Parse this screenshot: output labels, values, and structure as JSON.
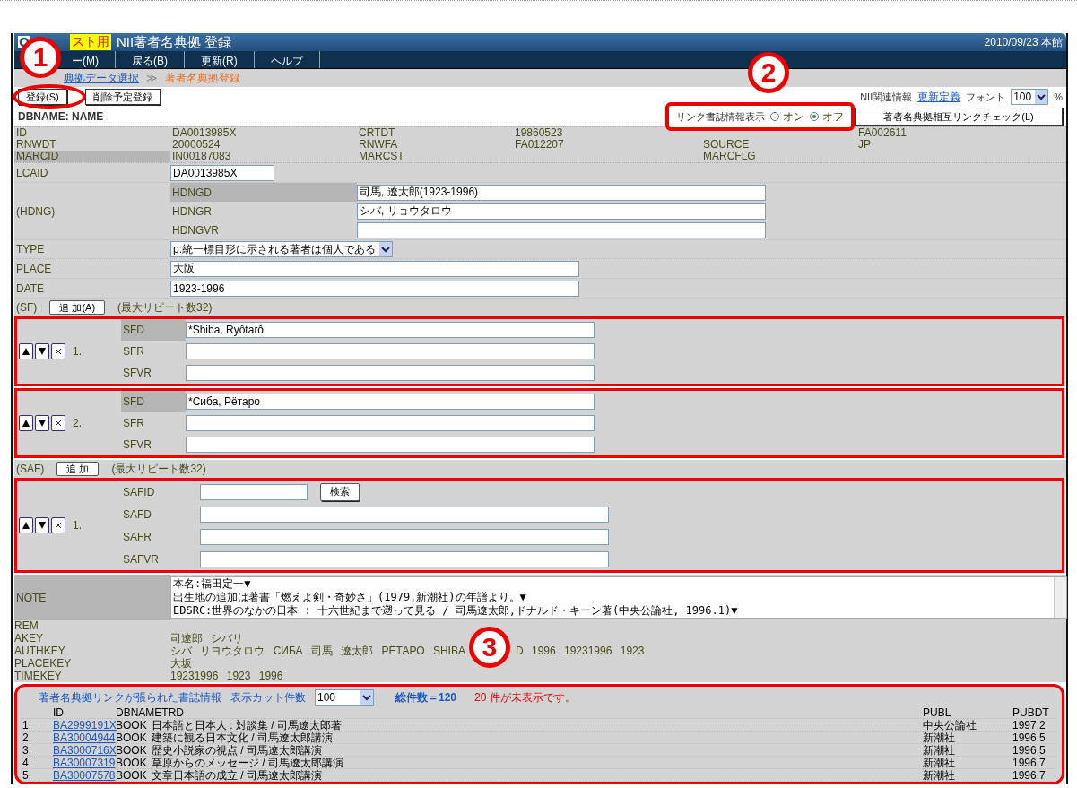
{
  "title_bar": {
    "badge": "スト用",
    "title": "NII著者名典拠 登録",
    "date": "2010/09/23 本館"
  },
  "menu": [
    "ー(M)",
    "戻る(B)",
    "更新(R)",
    "ヘルプ"
  ],
  "breadcrumb": {
    "link": "典拠データ選択",
    "separator": "≫",
    "current": "著者名典拠登録"
  },
  "actions": [
    "登録(S)",
    "削除予定登録"
  ],
  "top_links": {
    "label": "NII関連情報",
    "link": "更新定義",
    "font_label": "フォント",
    "font_value": "100",
    "unit": "%"
  },
  "dbname": "DBNAME: NAME",
  "link_display": {
    "label": "リンク書誌情報表示",
    "options": [
      {
        "label": "オン",
        "selected": false
      },
      {
        "label": "オフ",
        "selected": true
      }
    ]
  },
  "link_check_button": "著者名典拠相互リンクチェック(L)",
  "annotations": [
    "1",
    "2",
    "3"
  ],
  "info": [
    [
      {
        "label": "ID",
        "value": "DA0013985X"
      },
      {
        "label": "CRTDT",
        "value": "19860523"
      },
      {
        "value": "FA002611"
      }
    ],
    [
      {
        "label": "RNWDT",
        "value": "20000524"
      },
      {
        "label": "RNWFA",
        "value": "FA012207"
      },
      {
        "label": "SOURCE",
        "value": "JP"
      }
    ],
    [
      {
        "label": "MARCID",
        "value": "IN00187083",
        "highlighted": true
      },
      {
        "label": "MARCST"
      },
      {
        "label": "MARCFLG"
      }
    ]
  ],
  "lcaid": {
    "label": "LCAID",
    "value": "DA0013985X"
  },
  "hdng": {
    "label": "(HDNG)",
    "fields": [
      {
        "label": "HDNGD",
        "value": "司馬, 遼太郎(1923-1996)",
        "highlighted": true
      },
      {
        "label": "HDNGR",
        "value": "シバ, リョウタロウ",
        "highlighted": false
      },
      {
        "label": "HDNGVR",
        "highlighted": false
      }
    ]
  },
  "type": {
    "label": "TYPE",
    "value": "p:統一標目形に示される著者は個人である"
  },
  "place": {
    "label": "PLACE",
    "value": "大阪"
  },
  "date": {
    "label": "DATE",
    "value": "1923-1996"
  },
  "sf": {
    "label": "(SF)",
    "add": "追 加(A)",
    "note": "(最大リピート数32)",
    "entries": [
      {
        "number": "1.",
        "fields": [
          {
            "label": "SFD",
            "value": "*Shiba, Ryôtarô",
            "highlighted": true
          },
          {
            "label": "SFR",
            "highlighted": false
          },
          {
            "label": "SFVR",
            "highlighted": false
          }
        ]
      },
      {
        "number": "2.",
        "fields": [
          {
            "label": "SFD",
            "value": "*Сиба, Рётаро",
            "highlighted": true
          },
          {
            "label": "SFR",
            "highlighted": false
          },
          {
            "label": "SFVR",
            "highlighted": false
          }
        ]
      }
    ]
  },
  "saf": {
    "label": "(SAF)",
    "add": "追 加",
    "note": "(最大リピート数32)",
    "entries": [
      {
        "number": "1.",
        "id_label": "SAFID",
        "search": "検索",
        "fields": [
          {
            "label": "SAFD"
          },
          {
            "label": "SAFR"
          },
          {
            "label": "SAFVR"
          }
        ]
      }
    ]
  },
  "note": {
    "label": "NOTE",
    "lines": [
      "本名:福田定一▼",
      "出生地の追加は著書「燃えよ剣・奇妙さ」(1979,新潮社)の年譜より。▼",
      "EDSRC:世界のなかの日本 : 十六世紀まで遡って見る / 司馬遼太郎,ドナルド・キーン著(中央公論社, 1996.1)▼"
    ]
  },
  "keys": [
    {
      "label": "REM"
    },
    {
      "label": "AKEY",
      "value": "司遼郎 シバリ"
    },
    {
      "label": "AUTHKEY",
      "value": "シバ リヨウタロウ СИБА 司馬 遼太郎 РЁТАРО SHIBA",
      "value_after": "D 1996 19231996 1923"
    },
    {
      "label": "PLACEKEY",
      "value": "大坂"
    },
    {
      "label": "TIMEKEY",
      "value": "19231996 1923 1996"
    }
  ],
  "links": {
    "title": "著者名典拠リンクが張られた書誌情報",
    "cut_label": "表示カット件数",
    "cut_value": "100",
    "total": "総件数＝120",
    "warning": "20 件が未表示です。",
    "columns": [
      "ID",
      "DBNAMETRD",
      "PUBL",
      "PUBDT"
    ],
    "rows": [
      {
        "number": "1.",
        "id": "BA2999191X",
        "dbname": "BOOK",
        "trd": "日本語と日本人 : 対談集 / 司馬遼太郎著",
        "publ": "中央公論社",
        "pubdt": "1997.2"
      },
      {
        "number": "2.",
        "id": "BA30004944",
        "dbname": "BOOK",
        "trd": "建築に観る日本文化 / 司馬遼太郎講演",
        "publ": "新潮社",
        "pubdt": "1996.5"
      },
      {
        "number": "3.",
        "id": "BA3000716X",
        "dbname": "BOOK",
        "trd": "歴史小説家の視点 / 司馬遼太郎講演",
        "publ": "新潮社",
        "pubdt": "1996.5"
      },
      {
        "number": "4.",
        "id": "BA30007319",
        "dbname": "BOOK",
        "trd": "草原からのメッセージ / 司馬遼太郎講演",
        "publ": "新潮社",
        "pubdt": "1996.7"
      },
      {
        "number": "5.",
        "id": "BA30007578",
        "dbname": "BOOK",
        "trd": "文章日本語の成立 / 司馬遼太郎講演",
        "publ": "新潮社",
        "pubdt": "1996.7"
      }
    ]
  }
}
